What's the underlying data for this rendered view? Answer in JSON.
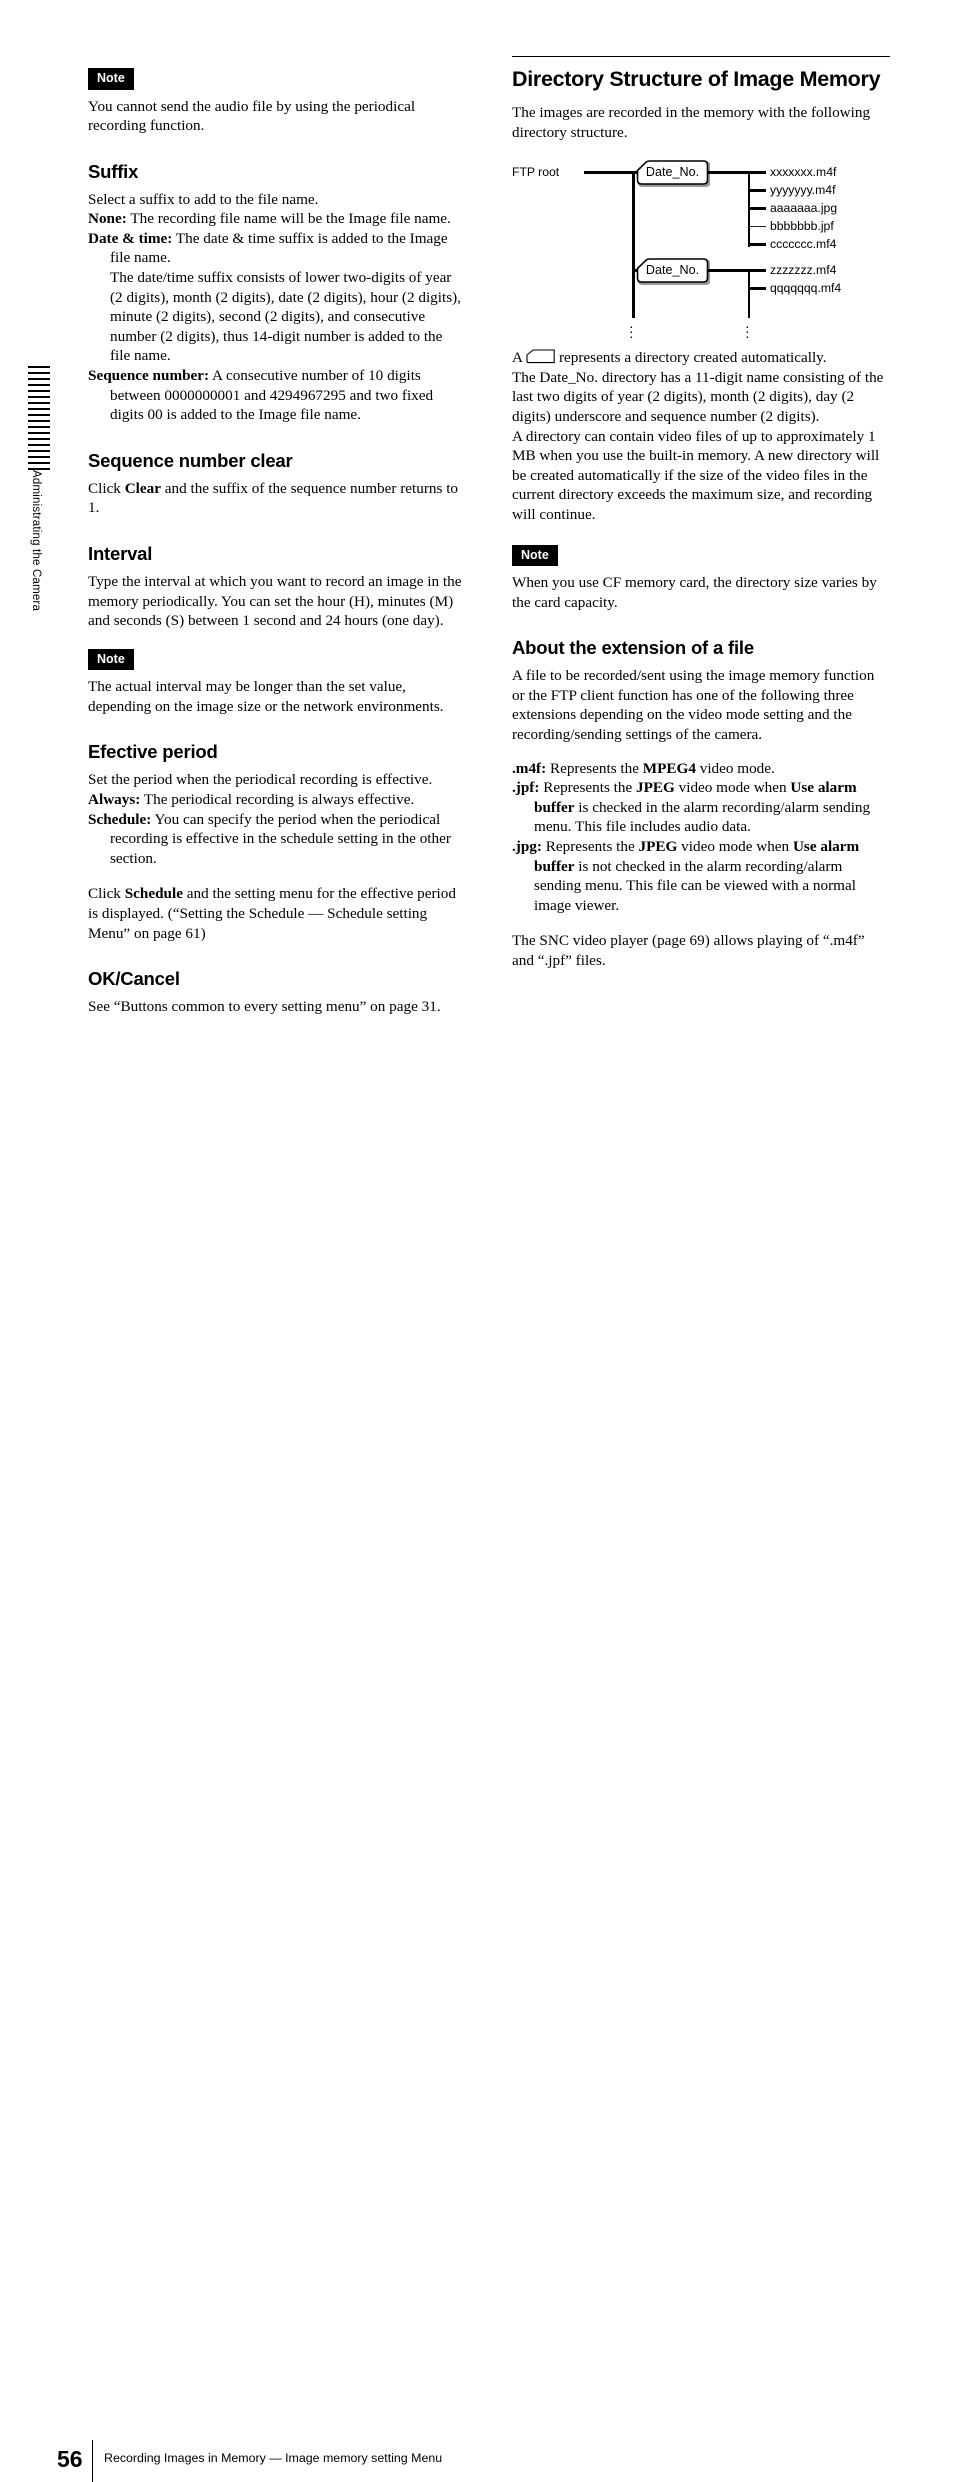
{
  "side_tab": {
    "label": "Administrating the Camera"
  },
  "left_column": {
    "note1": {
      "badge": "Note",
      "text": "You cannot send the audio file by using the periodical recording function."
    },
    "suffix": {
      "heading": "Suffix",
      "intro": "Select a suffix to add to the file name.",
      "items": [
        {
          "term": "None:",
          "text": " The recording file name will be the Image file name."
        },
        {
          "term": "Date & time:",
          "text": " The date & time suffix is added to the Image file name."
        },
        {
          "term": "",
          "text": "The date/time suffix consists of lower two-digits of year (2 digits), month (2 digits), date (2 digits), hour (2 digits), minute (2 digits), second (2 digits), and consecutive number (2 digits), thus 14-digit number is added to the file name."
        },
        {
          "term": "Sequence number:",
          "text": " A consecutive number of 10 digits between 0000000001 and 4294967295 and two fixed digits 00 is added to the Image file name."
        }
      ]
    },
    "sequence_clear": {
      "heading": "Sequence number clear",
      "text_before": "Click ",
      "bold": "Clear",
      "text_after": " and the suffix of the sequence number returns to 1."
    },
    "interval": {
      "heading": "Interval",
      "text": "Type the interval at which you want to record an image in the memory periodically. You can set the hour (H), minutes (M) and seconds (S) between 1 second and 24 hours (one day)."
    },
    "note2": {
      "badge": "Note",
      "text": "The actual interval may be longer than the set value, depending on the image size or the network environments."
    },
    "effective_period": {
      "heading": "Efective period",
      "intro": "Set the period when the periodical recording is effective.",
      "items": [
        {
          "term": "Always:",
          "text": " The periodical recording is always effective."
        },
        {
          "term": "Schedule:",
          "text": " You can specify the period when the periodical recording is effective in the schedule setting in the other section."
        }
      ],
      "paragraph_1": "Click ",
      "paragraph_bold": "Schedule",
      "paragraph_2": " and the setting menu for the effective period is displayed. (“Setting the Schedule — Schedule setting Menu” on page 61)"
    },
    "ok_cancel": {
      "heading": "OK/Cancel",
      "text": "See “Buttons common to every setting menu” on page 31."
    }
  },
  "right_column": {
    "title": "Directory Structure of Image Memory",
    "intro": "The images are recorded in the memory with the following directory structure.",
    "diagram": {
      "root_label": "FTP root",
      "directories": [
        {
          "label": "Date_No.",
          "files": [
            "xxxxxxx.m4f",
            "yyyyyyy.m4f",
            "aaaaaaa.jpg",
            "bbbbbbb.jpf",
            "ccccccc.mf4"
          ]
        },
        {
          "label": "Date_No.",
          "files": [
            "zzzzzzz.mf4",
            "qqqqqqq.mf4"
          ]
        }
      ],
      "ellipsis": "⋮"
    },
    "explanation": {
      "lead_a": "A",
      "folder_icon": "folder-icon",
      "after_icon": "represents a directory created automatically.",
      "paragraph_1": "The Date_No. directory has a 11-digit name consisting of the last two digits of year (2 digits), month (2 digits), day (2 digits) underscore and sequence number (2 digits).",
      "paragraph_2": "A directory can contain video files of up to approximately 1 MB when you use the built-in memory. A new directory will be created automatically if the size of the video files in the current directory exceeds the maximum size, and recording will continue."
    },
    "note3": {
      "badge": "Note",
      "text": "When you use CF memory card, the directory size varies by the card capacity."
    },
    "extension": {
      "heading": "About the extension of a file",
      "intro": "A file to be recorded/sent using the image memory function or the FTP client function has one of the following three extensions depending on the video mode setting and the recording/sending settings of the camera.",
      "items": [
        {
          "term": ".m4f:",
          "pre": " Represents the ",
          "bold1": "MPEG4",
          "mid": " video mode.",
          "bold2": "",
          "post": ""
        },
        {
          "term": ".jpf:",
          "pre": " Represents the ",
          "bold1": "JPEG",
          "mid": " video mode when ",
          "bold2": "Use alarm buffer",
          "post": " is checked in the alarm recording/alarm sending menu.  This file includes audio data."
        },
        {
          "term": ".jpg:",
          "pre": " Represents the ",
          "bold1": "JPEG",
          "mid": " video mode when ",
          "bold2": "Use alarm buffer",
          "post": " is not checked in the alarm recording/alarm sending menu. This file can be viewed with a normal image viewer."
        }
      ],
      "closing": "The SNC video player (page 69) allows playing of “.m4f” and “.jpf” files."
    }
  },
  "footer": {
    "page_number": "56",
    "text": "Recording Images in Memory — Image memory setting Menu"
  }
}
